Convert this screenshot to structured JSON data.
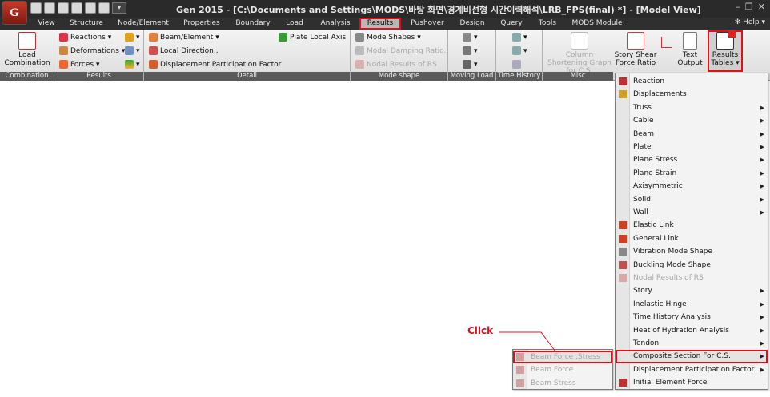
{
  "app": {
    "logo_letter": "G",
    "window_title": "Gen 2015 - [C:\\Documents and Settings\\MODS\\바탕 화면\\경계비선형 시간이력해석\\LRB_FPS(final) *] - [Model View]",
    "qat_more": "▾"
  },
  "menubar": {
    "tabs": [
      "View",
      "Structure",
      "Node/Element",
      "Properties",
      "Boundary",
      "Load",
      "Analysis",
      "Results",
      "Pushover",
      "Design",
      "Query",
      "Tools",
      "MODS Module"
    ],
    "active_tab": "Results",
    "help": "Help ▾"
  },
  "ribbon": {
    "groups": {
      "combination": "Combination",
      "results": "Results",
      "detail": "Detail",
      "mode_shape": "Mode shape",
      "moving_load": "Moving Load",
      "time_history": "Time History",
      "misc": "Misc"
    },
    "load_combination": "Load Combination",
    "reactions": "Reactions",
    "deformations": "Deformations",
    "forces": "Forces",
    "beam_element": "Beam/Element",
    "local_direction": "Local Direction..",
    "displacement_participation_factor": "Displacement Participation Factor",
    "plate_local_axis": "Plate Local Axis",
    "mode_shapes": "Mode Shapes",
    "modal_damping_ratio": "Modal Damping Ratio..",
    "nodal_results_of_rs": "Nodal Results of RS",
    "column_shortening": "Column Shortening Graph for C.S.",
    "story_shear": "Story Shear Force Ratio",
    "text_output": "Text Output",
    "results_tables": "Results Tables"
  },
  "results_menu": {
    "items": [
      {
        "label": "Reaction",
        "submenu": false,
        "disabled": false
      },
      {
        "label": "Displacements",
        "submenu": false,
        "disabled": false
      },
      {
        "label": "Truss",
        "submenu": true,
        "disabled": false
      },
      {
        "label": "Cable",
        "submenu": true,
        "disabled": false
      },
      {
        "label": "Beam",
        "submenu": true,
        "disabled": false
      },
      {
        "label": "Plate",
        "submenu": true,
        "disabled": false
      },
      {
        "label": "Plane Stress",
        "submenu": true,
        "disabled": false
      },
      {
        "label": "Plane Strain",
        "submenu": true,
        "disabled": false
      },
      {
        "label": "Axisymmetric",
        "submenu": true,
        "disabled": false
      },
      {
        "label": "Solid",
        "submenu": true,
        "disabled": false
      },
      {
        "label": "Wall",
        "submenu": true,
        "disabled": false
      },
      {
        "label": "Elastic Link",
        "submenu": false,
        "disabled": false
      },
      {
        "label": "General Link",
        "submenu": false,
        "disabled": false
      },
      {
        "label": "Vibration Mode Shape",
        "submenu": false,
        "disabled": false
      },
      {
        "label": "Buckling Mode Shape",
        "submenu": false,
        "disabled": false
      },
      {
        "label": "Nodal Results of RS",
        "submenu": false,
        "disabled": true
      },
      {
        "label": "Story",
        "submenu": true,
        "disabled": false
      },
      {
        "label": "Inelastic Hinge",
        "submenu": true,
        "disabled": false
      },
      {
        "label": "Time History Analysis",
        "submenu": true,
        "disabled": false
      },
      {
        "label": "Heat of Hydration Analysis",
        "submenu": true,
        "disabled": false
      },
      {
        "label": "Tendon",
        "submenu": true,
        "disabled": false
      },
      {
        "label": "Composite Section For C.S.",
        "submenu": true,
        "disabled": false,
        "highlight": true
      },
      {
        "label": "Displacement Participation Factor",
        "submenu": true,
        "disabled": false
      },
      {
        "label": "Initial Element Force",
        "submenu": false,
        "disabled": false
      }
    ]
  },
  "composite_submenu": {
    "items": [
      {
        "label": "Beam Force ,Stress",
        "highlight": true
      },
      {
        "label": "Beam Force"
      },
      {
        "label": "Beam Stress"
      }
    ]
  },
  "annotation": {
    "click_label": "Click"
  },
  "colors": {
    "highlight_red": "#e0101a"
  }
}
